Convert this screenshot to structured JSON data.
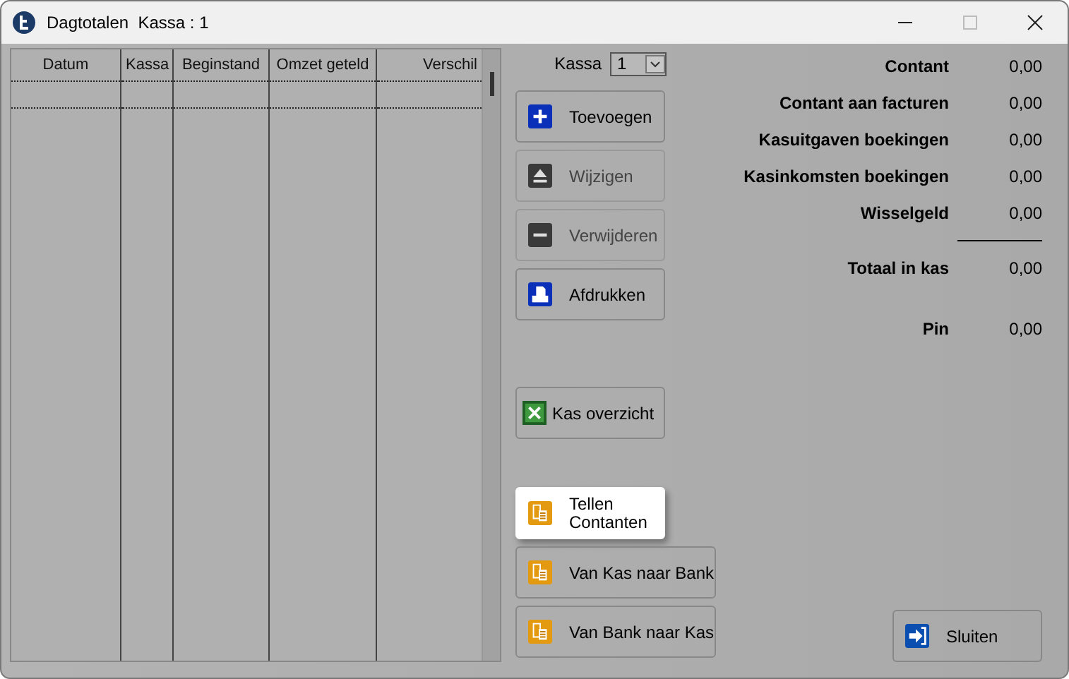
{
  "window": {
    "title": "Dagtotalen  Kassa : 1"
  },
  "table": {
    "columns": [
      "Datum",
      "Kassa",
      "Beginstand",
      "Omzet geteld",
      "Verschil"
    ]
  },
  "kassa": {
    "label": "Kassa",
    "value": "1"
  },
  "button_groups": [
    [
      {
        "label": "Toevoegen",
        "disabled": false,
        "highlighted": false
      },
      {
        "label": "Wijzigen",
        "disabled": true,
        "highlighted": false
      },
      {
        "label": "Verwijderen",
        "disabled": true,
        "highlighted": false
      },
      {
        "label": "Afdrukken",
        "disabled": false,
        "highlighted": false
      }
    ],
    [
      {
        "label": "Kas overzicht",
        "disabled": false,
        "highlighted": false
      }
    ],
    [
      {
        "label": "Tellen Contanten",
        "disabled": false,
        "highlighted": true
      },
      {
        "label": "Van Kas naar Bank",
        "disabled": false,
        "highlighted": false
      },
      {
        "label": "Van Bank naar Kas",
        "disabled": false,
        "highlighted": false
      }
    ]
  ],
  "totals": [
    {
      "kind": "row",
      "label": "Contant",
      "value": "0,00"
    },
    {
      "kind": "row",
      "label": "Contant aan facturen",
      "value": "0,00"
    },
    {
      "kind": "row",
      "label": "Kasuitgaven boekingen",
      "value": "0,00"
    },
    {
      "kind": "row",
      "label": "Kasinkomsten boekingen",
      "value": "0,00"
    },
    {
      "kind": "row",
      "label": "Wisselgeld",
      "value": "0,00"
    },
    {
      "kind": "rule"
    },
    {
      "kind": "row",
      "label": "Totaal in kas",
      "value": "0,00"
    },
    {
      "kind": "gap"
    },
    {
      "kind": "row",
      "label": "Pin",
      "value": "0,00"
    }
  ],
  "close_button": {
    "label": "Sluiten"
  }
}
